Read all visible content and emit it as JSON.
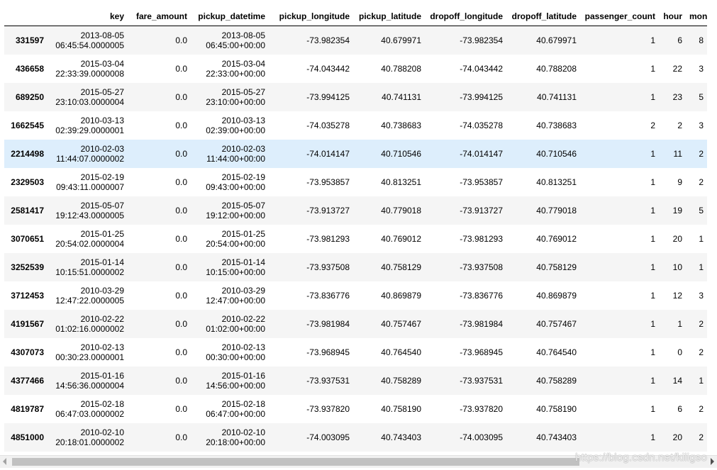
{
  "table": {
    "columns": [
      "",
      "key",
      "fare_amount",
      "pickup_datetime",
      "pickup_longitude",
      "pickup_latitude",
      "dropoff_longitude",
      "dropoff_latitude",
      "passenger_count",
      "hour",
      "month"
    ],
    "rows": [
      {
        "index": "331597",
        "key_date": "2013-08-05",
        "key_time": "06:45:54.0000005",
        "fare_amount": "0.0",
        "pickup_date": "2013-08-05",
        "pickup_time": "06:45:00+00:00",
        "pickup_longitude": "-73.982354",
        "pickup_latitude": "40.679971",
        "dropoff_longitude": "-73.982354",
        "dropoff_latitude": "40.679971",
        "passenger_count": "1",
        "hour": "6",
        "month": "8"
      },
      {
        "index": "436658",
        "key_date": "2015-03-04",
        "key_time": "22:33:39.0000008",
        "fare_amount": "0.0",
        "pickup_date": "2015-03-04",
        "pickup_time": "22:33:00+00:00",
        "pickup_longitude": "-74.043442",
        "pickup_latitude": "40.788208",
        "dropoff_longitude": "-74.043442",
        "dropoff_latitude": "40.788208",
        "passenger_count": "1",
        "hour": "22",
        "month": "3"
      },
      {
        "index": "689250",
        "key_date": "2015-05-27",
        "key_time": "23:10:03.0000004",
        "fare_amount": "0.0",
        "pickup_date": "2015-05-27",
        "pickup_time": "23:10:00+00:00",
        "pickup_longitude": "-73.994125",
        "pickup_latitude": "40.741131",
        "dropoff_longitude": "-73.994125",
        "dropoff_latitude": "40.741131",
        "passenger_count": "1",
        "hour": "23",
        "month": "5"
      },
      {
        "index": "1662545",
        "key_date": "2010-03-13",
        "key_time": "02:39:29.0000001",
        "fare_amount": "0.0",
        "pickup_date": "2010-03-13",
        "pickup_time": "02:39:00+00:00",
        "pickup_longitude": "-74.035278",
        "pickup_latitude": "40.738683",
        "dropoff_longitude": "-74.035278",
        "dropoff_latitude": "40.738683",
        "passenger_count": "2",
        "hour": "2",
        "month": "3"
      },
      {
        "index": "2214498",
        "key_date": "2010-02-03",
        "key_time": "11:44:07.0000002",
        "fare_amount": "0.0",
        "pickup_date": "2010-02-03",
        "pickup_time": "11:44:00+00:00",
        "pickup_longitude": "-74.014147",
        "pickup_latitude": "40.710546",
        "dropoff_longitude": "-74.014147",
        "dropoff_latitude": "40.710546",
        "passenger_count": "1",
        "hour": "11",
        "month": "2"
      },
      {
        "index": "2329503",
        "key_date": "2015-02-19",
        "key_time": "09:43:11.0000007",
        "fare_amount": "0.0",
        "pickup_date": "2015-02-19",
        "pickup_time": "09:43:00+00:00",
        "pickup_longitude": "-73.953857",
        "pickup_latitude": "40.813251",
        "dropoff_longitude": "-73.953857",
        "dropoff_latitude": "40.813251",
        "passenger_count": "1",
        "hour": "9",
        "month": "2"
      },
      {
        "index": "2581417",
        "key_date": "2015-05-07",
        "key_time": "19:12:43.0000005",
        "fare_amount": "0.0",
        "pickup_date": "2015-05-07",
        "pickup_time": "19:12:00+00:00",
        "pickup_longitude": "-73.913727",
        "pickup_latitude": "40.779018",
        "dropoff_longitude": "-73.913727",
        "dropoff_latitude": "40.779018",
        "passenger_count": "1",
        "hour": "19",
        "month": "5"
      },
      {
        "index": "3070651",
        "key_date": "2015-01-25",
        "key_time": "20:54:02.0000004",
        "fare_amount": "0.0",
        "pickup_date": "2015-01-25",
        "pickup_time": "20:54:00+00:00",
        "pickup_longitude": "-73.981293",
        "pickup_latitude": "40.769012",
        "dropoff_longitude": "-73.981293",
        "dropoff_latitude": "40.769012",
        "passenger_count": "1",
        "hour": "20",
        "month": "1"
      },
      {
        "index": "3252539",
        "key_date": "2015-01-14",
        "key_time": "10:15:51.0000002",
        "fare_amount": "0.0",
        "pickup_date": "2015-01-14",
        "pickup_time": "10:15:00+00:00",
        "pickup_longitude": "-73.937508",
        "pickup_latitude": "40.758129",
        "dropoff_longitude": "-73.937508",
        "dropoff_latitude": "40.758129",
        "passenger_count": "1",
        "hour": "10",
        "month": "1"
      },
      {
        "index": "3712453",
        "key_date": "2010-03-29",
        "key_time": "12:47:22.0000005",
        "fare_amount": "0.0",
        "pickup_date": "2010-03-29",
        "pickup_time": "12:47:00+00:00",
        "pickup_longitude": "-73.836776",
        "pickup_latitude": "40.869879",
        "dropoff_longitude": "-73.836776",
        "dropoff_latitude": "40.869879",
        "passenger_count": "1",
        "hour": "12",
        "month": "3"
      },
      {
        "index": "4191567",
        "key_date": "2010-02-22",
        "key_time": "01:02:16.0000002",
        "fare_amount": "0.0",
        "pickup_date": "2010-02-22",
        "pickup_time": "01:02:00+00:00",
        "pickup_longitude": "-73.981984",
        "pickup_latitude": "40.757467",
        "dropoff_longitude": "-73.981984",
        "dropoff_latitude": "40.757467",
        "passenger_count": "1",
        "hour": "1",
        "month": "2"
      },
      {
        "index": "4307073",
        "key_date": "2010-02-13",
        "key_time": "00:30:23.0000001",
        "fare_amount": "0.0",
        "pickup_date": "2010-02-13",
        "pickup_time": "00:30:00+00:00",
        "pickup_longitude": "-73.968945",
        "pickup_latitude": "40.764540",
        "dropoff_longitude": "-73.968945",
        "dropoff_latitude": "40.764540",
        "passenger_count": "1",
        "hour": "0",
        "month": "2"
      },
      {
        "index": "4377466",
        "key_date": "2015-01-16",
        "key_time": "14:56:36.0000004",
        "fare_amount": "0.0",
        "pickup_date": "2015-01-16",
        "pickup_time": "14:56:00+00:00",
        "pickup_longitude": "-73.937531",
        "pickup_latitude": "40.758289",
        "dropoff_longitude": "-73.937531",
        "dropoff_latitude": "40.758289",
        "passenger_count": "1",
        "hour": "14",
        "month": "1"
      },
      {
        "index": "4819787",
        "key_date": "2015-02-18",
        "key_time": "06:47:03.0000002",
        "fare_amount": "0.0",
        "pickup_date": "2015-02-18",
        "pickup_time": "06:47:00+00:00",
        "pickup_longitude": "-73.937820",
        "pickup_latitude": "40.758190",
        "dropoff_longitude": "-73.937820",
        "dropoff_latitude": "40.758190",
        "passenger_count": "1",
        "hour": "6",
        "month": "2"
      },
      {
        "index": "4851000",
        "key_date": "2010-02-10",
        "key_time": "20:18:01.0000002",
        "fare_amount": "0.0",
        "pickup_date": "2010-02-10",
        "pickup_time": "20:18:00+00:00",
        "pickup_longitude": "-74.003095",
        "pickup_latitude": "40.743403",
        "dropoff_longitude": "-74.003095",
        "dropoff_latitude": "40.743403",
        "passenger_count": "1",
        "hour": "20",
        "month": "2"
      }
    ]
  },
  "watermark": "https://blog.csdn.net/kiligso",
  "colors": {
    "stripe": "#f5f5f5",
    "hover_row": "#ddeefc",
    "scroll_thumb": "#c1c1c1",
    "scroll_track": "#f1f1f1"
  },
  "hover_row_index": 4
}
